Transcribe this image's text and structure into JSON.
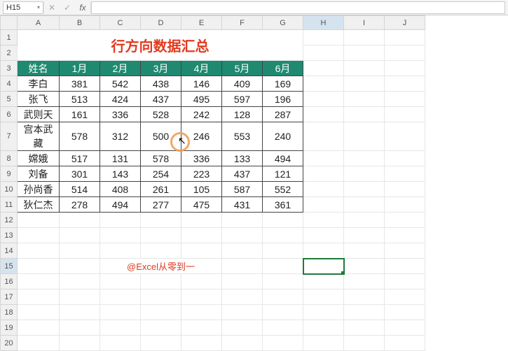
{
  "cell_ref": "H15",
  "title": "行方向数据汇总",
  "headers": [
    "姓名",
    "1月",
    "2月",
    "3月",
    "4月",
    "5月",
    "6月"
  ],
  "rows": [
    {
      "name": "李白",
      "v": [
        381,
        542,
        438,
        146,
        409,
        169
      ]
    },
    {
      "name": "张飞",
      "v": [
        513,
        424,
        437,
        495,
        597,
        196
      ]
    },
    {
      "name": "武则天",
      "v": [
        161,
        336,
        528,
        242,
        128,
        287
      ]
    },
    {
      "name": "宫本武藏",
      "v": [
        578,
        312,
        500,
        246,
        553,
        240
      ]
    },
    {
      "name": "嫦娥",
      "v": [
        517,
        131,
        578,
        336,
        133,
        494
      ]
    },
    {
      "name": "刘备",
      "v": [
        301,
        143,
        254,
        223,
        437,
        121
      ]
    },
    {
      "name": "孙尚香",
      "v": [
        514,
        408,
        261,
        105,
        587,
        552
      ]
    },
    {
      "name": "狄仁杰",
      "v": [
        278,
        494,
        277,
        475,
        431,
        361
      ]
    }
  ],
  "watermark": "@Excel从零到一",
  "columns": [
    "A",
    "B",
    "C",
    "D",
    "E",
    "F",
    "G",
    "H",
    "I",
    "J"
  ],
  "row_numbers": [
    1,
    2,
    3,
    4,
    5,
    6,
    7,
    8,
    9,
    10,
    11,
    12,
    13,
    14,
    15,
    16,
    17,
    18,
    19,
    20
  ],
  "fx": "fx",
  "fx_cancel": "✕",
  "fx_accept": "✓"
}
